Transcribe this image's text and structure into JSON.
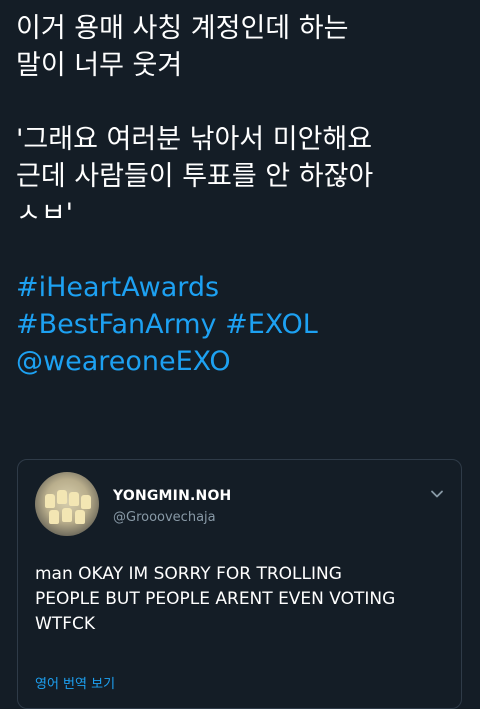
{
  "tweet": {
    "lines": [
      "이거 용매 사칭 계정인데 하는",
      "말이 너무 웃겨",
      "",
      "'그래요 여러분 낚아서 미안해요",
      "근데 사람들이 투표를 안 하잖아",
      "ㅅㅂ'"
    ],
    "hashtags": [
      "#iHeartAwards",
      "#BestFanArmy",
      "#EXOL",
      "@weareoneEXO"
    ]
  },
  "quote": {
    "display_name": "YONGMIN.NOH",
    "handle": "@Grooovechaja",
    "avatar_icon": "avatar-figurines",
    "menu_icon": "chevron-down-icon",
    "body_lines": [
      "man OKAY IM SORRY FOR TROLLING",
      "PEOPLE BUT PEOPLE ARENT EVEN VOTING",
      "WTFCK"
    ],
    "translate_label": "영어 번역 보기"
  },
  "colors": {
    "background": "#141d26",
    "link": "#1da1f2",
    "muted": "#8899a6",
    "border": "#2f3b48"
  }
}
